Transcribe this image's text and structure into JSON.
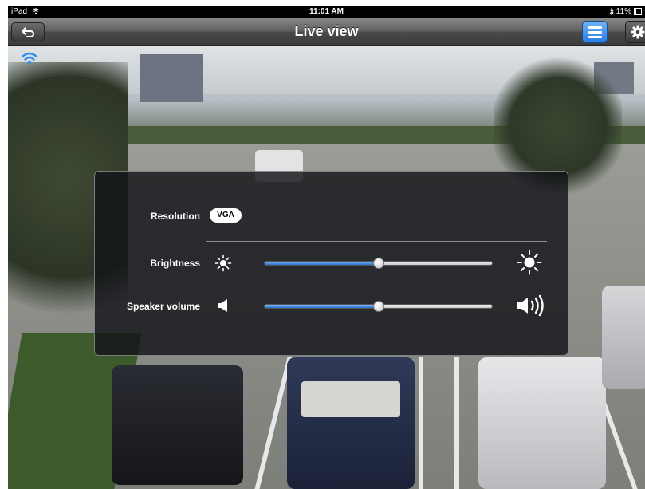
{
  "status_bar": {
    "device": "iPad",
    "time": "11:01 AM",
    "battery": "11%"
  },
  "nav": {
    "title": "Live view"
  },
  "icons": {
    "back": "back-arrow-icon",
    "menu": "list-menu-icon",
    "settings": "gear-icon",
    "wifi": "wifi-icon",
    "bluetooth": "bluetooth-icon",
    "brightness_low": "sun-small-icon",
    "brightness_high": "sun-large-icon",
    "volume_low": "speaker-low-icon",
    "volume_high": "speaker-high-icon"
  },
  "colors": {
    "accent": "#2b7de3",
    "panel_bg": "#141618",
    "slider_fill": "#3a7fd8"
  },
  "panel": {
    "resolution": {
      "label": "Resolution",
      "value": "VGA"
    },
    "brightness": {
      "label": "Brightness",
      "level": 0.5
    },
    "speaker_volume": {
      "label": "Speaker volume",
      "level": 0.5
    }
  }
}
